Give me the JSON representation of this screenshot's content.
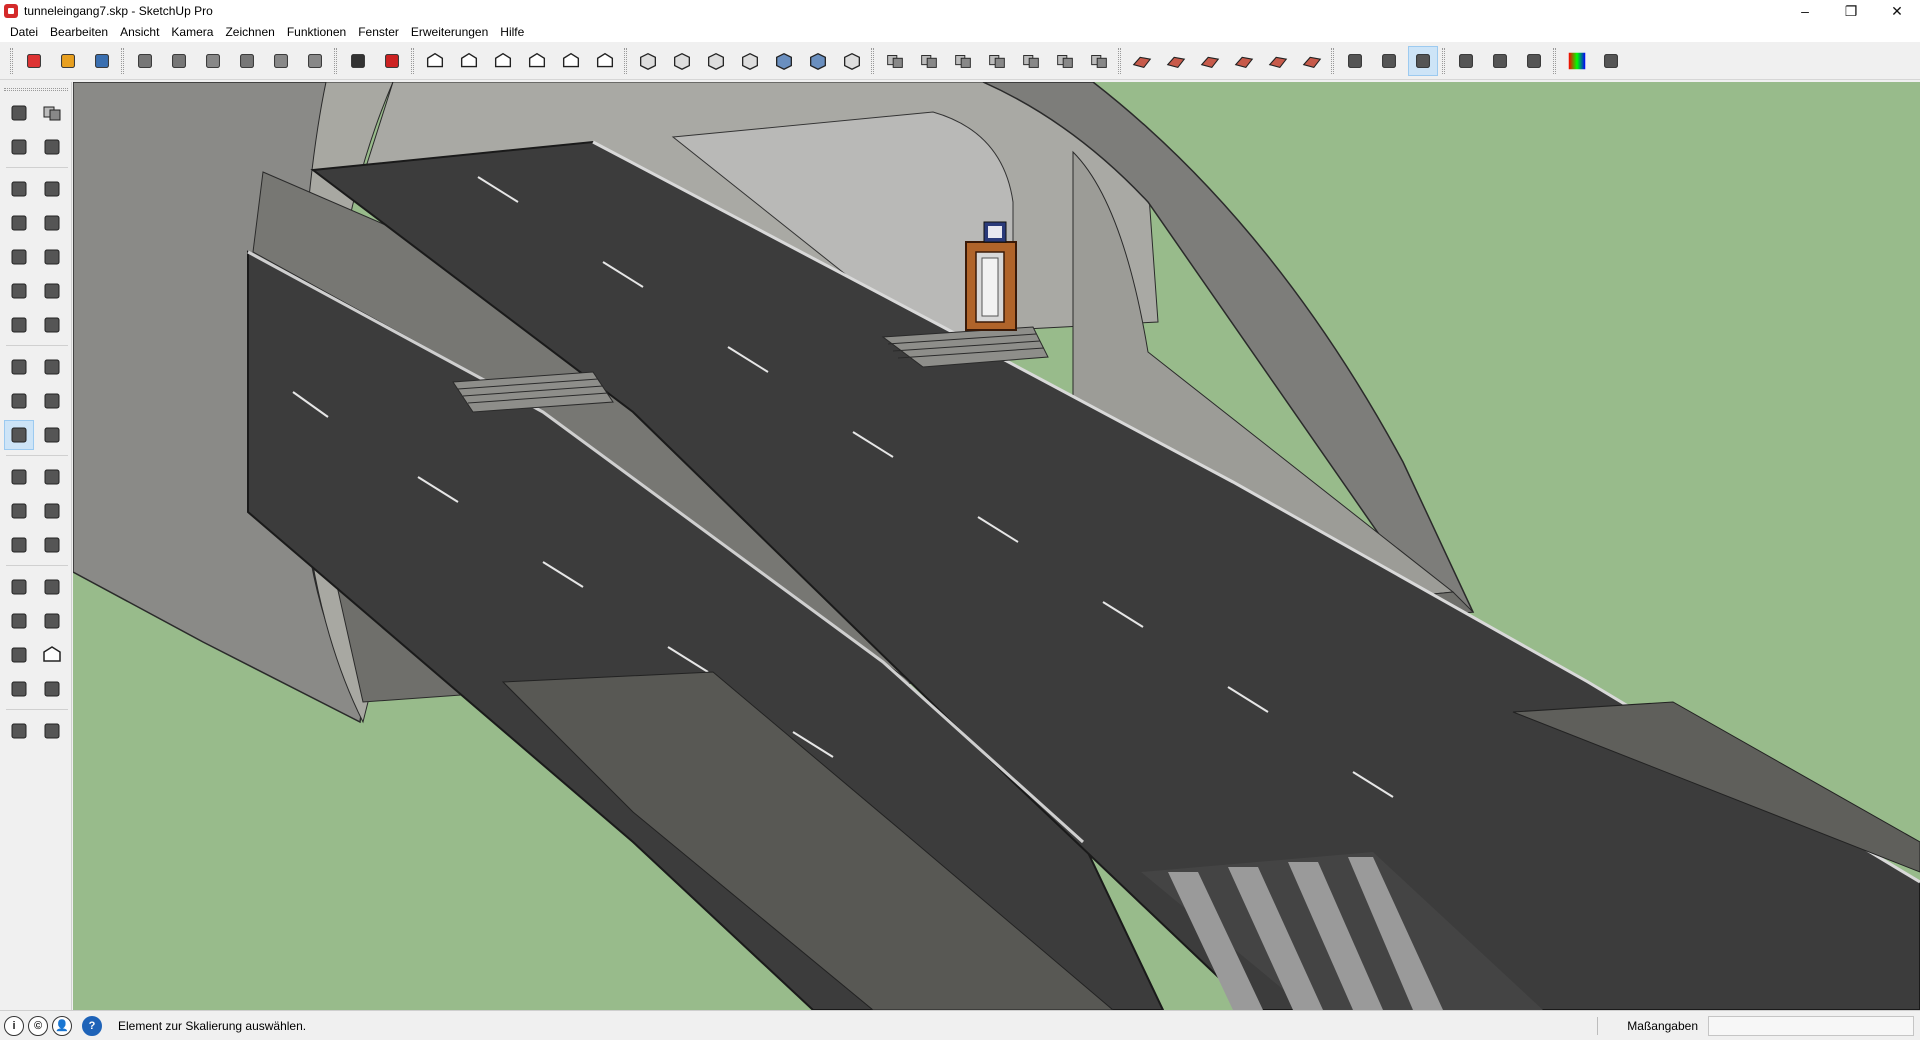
{
  "window": {
    "title": "tunneleingang7.skp - SketchUp Pro",
    "controls": [
      "–",
      "❐",
      "✕"
    ]
  },
  "menu": [
    {
      "label": "Datei"
    },
    {
      "label": "Bearbeiten"
    },
    {
      "label": "Ansicht"
    },
    {
      "label": "Kamera"
    },
    {
      "label": "Zeichnen"
    },
    {
      "label": "Funktionen"
    },
    {
      "label": "Fenster"
    },
    {
      "label": "Erweiterungen"
    },
    {
      "label": "Hilfe"
    }
  ],
  "toolbar": {
    "groups": [
      [
        "new-model-icon",
        "open-icon",
        "save-icon"
      ],
      [
        "cut-icon",
        "copy-icon",
        "paste-icon",
        "erase-icon",
        "undo-icon",
        "redo-icon"
      ],
      [
        "print-icon",
        "model-info-icon"
      ],
      [
        "iso-view-icon",
        "top-view-icon",
        "front-view-icon",
        "right-view-icon",
        "back-view-icon",
        "left-view-icon"
      ],
      [
        "xray-icon",
        "back-edges-icon",
        "wireframe-icon",
        "hidden-line-icon",
        "shaded-icon",
        "shaded-textures-icon",
        "monochrome-icon"
      ],
      [
        "components-icon",
        "group-icon",
        "outer-shell-icon",
        "intersect-icon",
        "union-icon",
        "subtract-icon",
        "trim-icon"
      ],
      [
        "sandbox-from-contours-icon",
        "sandbox-from-scratch-icon",
        "smoove-icon",
        "stamp-icon",
        "drape-icon",
        "add-detail-icon"
      ],
      [
        "orbit-target-icon",
        "section-plane-icon",
        "section-display-icon"
      ],
      [
        "axes-icon",
        "dimension-icon",
        "guides-icon"
      ],
      [
        "styles-icon",
        "select-tool-icon"
      ]
    ],
    "active": "section-display-icon"
  },
  "left_tools": [
    "select-icon",
    "make-component-icon",
    "paint-bucket-icon",
    "eraser-icon",
    "line-icon",
    "freehand-icon",
    "rectangle-icon",
    "rotated-rectangle-icon",
    "circle-icon",
    "polygon-icon",
    "arc-icon",
    "two-point-arc-icon",
    "three-point-arc-icon",
    "pie-icon",
    "move-icon",
    "push-pull-icon",
    "rotate-icon",
    "follow-me-icon",
    "scale-icon",
    "offset-icon",
    "tape-measure-icon",
    "dimension-tool-icon",
    "protractor-icon",
    "text-icon",
    "axes-tool-icon",
    "3d-text-icon",
    "orbit-icon",
    "pan-icon",
    "zoom-icon",
    "zoom-window-icon",
    "zoom-extents-icon",
    "previous-view-icon",
    "position-camera-icon",
    "look-around-icon",
    "walk-icon",
    "section-plane-tool-icon"
  ],
  "left_active": "scale-icon",
  "status": {
    "icons": [
      "i",
      "©",
      "👤"
    ],
    "message": "Element zur Skalierung auswählen.",
    "measure_label": "Maßangaben",
    "measure_value": ""
  }
}
